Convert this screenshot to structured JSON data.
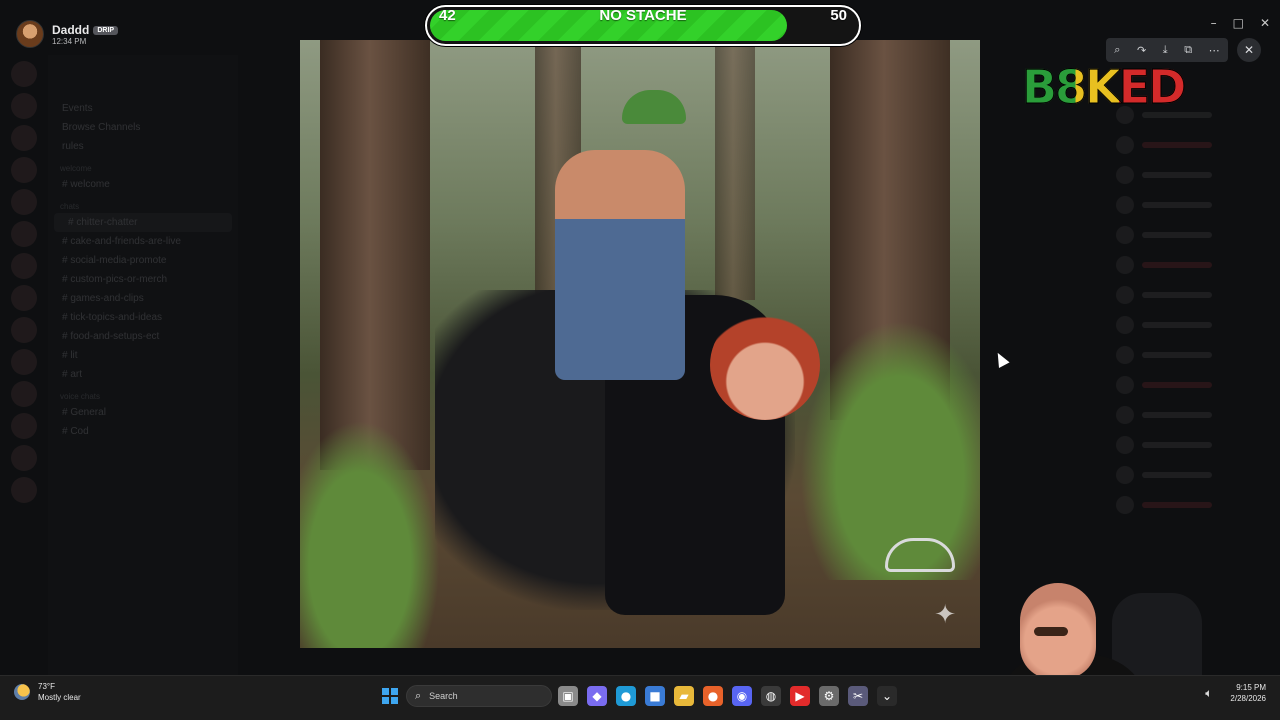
{
  "stream_overlay": {
    "stache_meter": {
      "current": "42",
      "label": "NO STACHE",
      "max": "50",
      "fill_fraction": 0.84,
      "color": "#33d12a"
    },
    "logo_text": "B8KED"
  },
  "discord": {
    "user": {
      "name": "Daddd",
      "badge": "DRIP",
      "time": "12:34 PM"
    },
    "channels": [
      {
        "type": "item",
        "label": "Events"
      },
      {
        "type": "item",
        "label": "Browse Channels"
      },
      {
        "type": "item",
        "label": "rules"
      },
      {
        "type": "category",
        "label": "welcome"
      },
      {
        "type": "channel",
        "label": "welcome"
      },
      {
        "type": "category",
        "label": "chats"
      },
      {
        "type": "channel",
        "label": "chitter-chatter",
        "active": true
      },
      {
        "type": "channel",
        "label": "cake-and-friends-are-live"
      },
      {
        "type": "channel",
        "label": "social-media-promote"
      },
      {
        "type": "channel",
        "label": "custom-pics-or-merch"
      },
      {
        "type": "channel",
        "label": "games-and-clips"
      },
      {
        "type": "channel",
        "label": "tick-topics-and-ideas"
      },
      {
        "type": "channel",
        "label": "food-and-setups-ect"
      },
      {
        "type": "channel",
        "label": "lit"
      },
      {
        "type": "channel",
        "label": "art"
      },
      {
        "type": "category",
        "label": "voice chats"
      },
      {
        "type": "channel",
        "label": "General"
      },
      {
        "type": "channel",
        "label": "Cod"
      }
    ],
    "member_rows": 14
  },
  "image_viewer": {
    "tools": [
      "zoom-in-icon",
      "forward-icon",
      "download-icon",
      "open-external-icon",
      "more-icon"
    ],
    "close_label": "✕"
  },
  "taskbar": {
    "weather": {
      "temp": "73°F",
      "condition": "Mostly clear"
    },
    "search_label": "Search",
    "apps": [
      {
        "name": "task-view-icon",
        "glyph": "▣",
        "color": "#8a8a8a"
      },
      {
        "name": "copilot-icon",
        "glyph": "◆",
        "color": "#7a6cf0"
      },
      {
        "name": "edge-icon",
        "glyph": "●",
        "color": "#1f9ad6"
      },
      {
        "name": "store-icon",
        "glyph": "■",
        "color": "#3a7bd5"
      },
      {
        "name": "file-explorer-icon",
        "glyph": "▰",
        "color": "#e8b83a"
      },
      {
        "name": "firefox-icon",
        "glyph": "●",
        "color": "#e8622a"
      },
      {
        "name": "discord-icon",
        "glyph": "◉",
        "color": "#5865f2"
      },
      {
        "name": "obs-icon",
        "glyph": "◍",
        "color": "#3a3a3a"
      },
      {
        "name": "youtube-icon",
        "glyph": "▶",
        "color": "#e22b2b"
      },
      {
        "name": "settings-icon",
        "glyph": "⚙",
        "color": "#6a6a6a"
      },
      {
        "name": "snip-icon",
        "glyph": "✂",
        "color": "#5a5a7a"
      },
      {
        "name": "chevron-icon",
        "glyph": "⌄",
        "color": "#2a2a2a"
      }
    ],
    "clock": {
      "time": "9:15 PM",
      "date": "2/28/2026"
    }
  }
}
